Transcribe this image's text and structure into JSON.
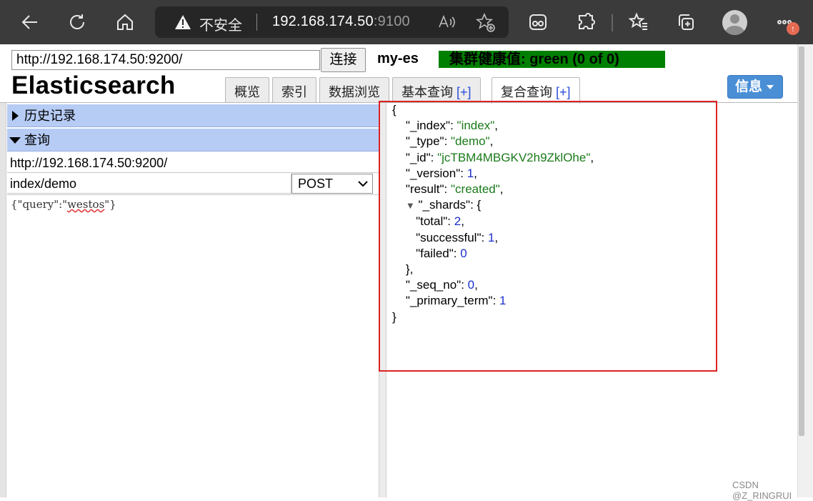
{
  "browser": {
    "security_label": "不安全",
    "url_host": "192.168.174.50",
    "url_port": ":9100"
  },
  "header": {
    "connect_url": "http://192.168.174.50:9200/",
    "connect_button": "连接",
    "cluster_name": "my-es",
    "cluster_health": "集群健康值: green (0 of 0)",
    "logo": "Elasticsearch",
    "info_button": "信息"
  },
  "tabs": [
    {
      "label": "概览",
      "plus": ""
    },
    {
      "label": "索引",
      "plus": ""
    },
    {
      "label": "数据浏览",
      "plus": ""
    },
    {
      "label": "基本查询 ",
      "plus": "[+]"
    },
    {
      "label": "复合查询 ",
      "plus": "[+]"
    }
  ],
  "left": {
    "history_label": "历史记录",
    "query_label": "查询",
    "query_url": "http://192.168.174.50:9200/",
    "query_path": "index/demo",
    "method": "POST",
    "body_prefix": "{\"query\":\"",
    "body_word": "westos",
    "body_suffix": "\"}"
  },
  "response": {
    "open": "{",
    "index_key": "\"_index\"",
    "index_val": "\"index\"",
    "type_key": "\"_type\"",
    "type_val": "\"demo\"",
    "id_key": "\"_id\"",
    "id_val": "\"jcTBM4MBGKV2h9ZklOhe\"",
    "version_key": "\"_version\"",
    "version_val": "1",
    "result_key": "\"result\"",
    "result_val": "\"created\"",
    "shards_key": "\"_shards\"",
    "total_key": "\"total\"",
    "total_val": "2",
    "successful_key": "\"successful\"",
    "successful_val": "1",
    "failed_key": "\"failed\"",
    "failed_val": "0",
    "seq_key": "\"_seq_no\"",
    "seq_val": "0",
    "term_key": "\"_primary_term\"",
    "term_val": "1",
    "close": "}"
  },
  "watermark": "CSDN @Z_RINGRUI",
  "colors": {
    "health_green": "#008000",
    "section_blue": "#b6ccf5",
    "json_string": "#1a7a1a",
    "json_number": "#1a2fcc",
    "highlight_box": "#dd2222"
  },
  "icons": [
    "back-icon",
    "refresh-icon",
    "home-icon",
    "warning-icon",
    "read-aloud-icon",
    "favorite-add-icon",
    "tracking-icon",
    "extensions-icon",
    "favorites-icon",
    "collections-icon",
    "profile-icon",
    "more-icon"
  ]
}
